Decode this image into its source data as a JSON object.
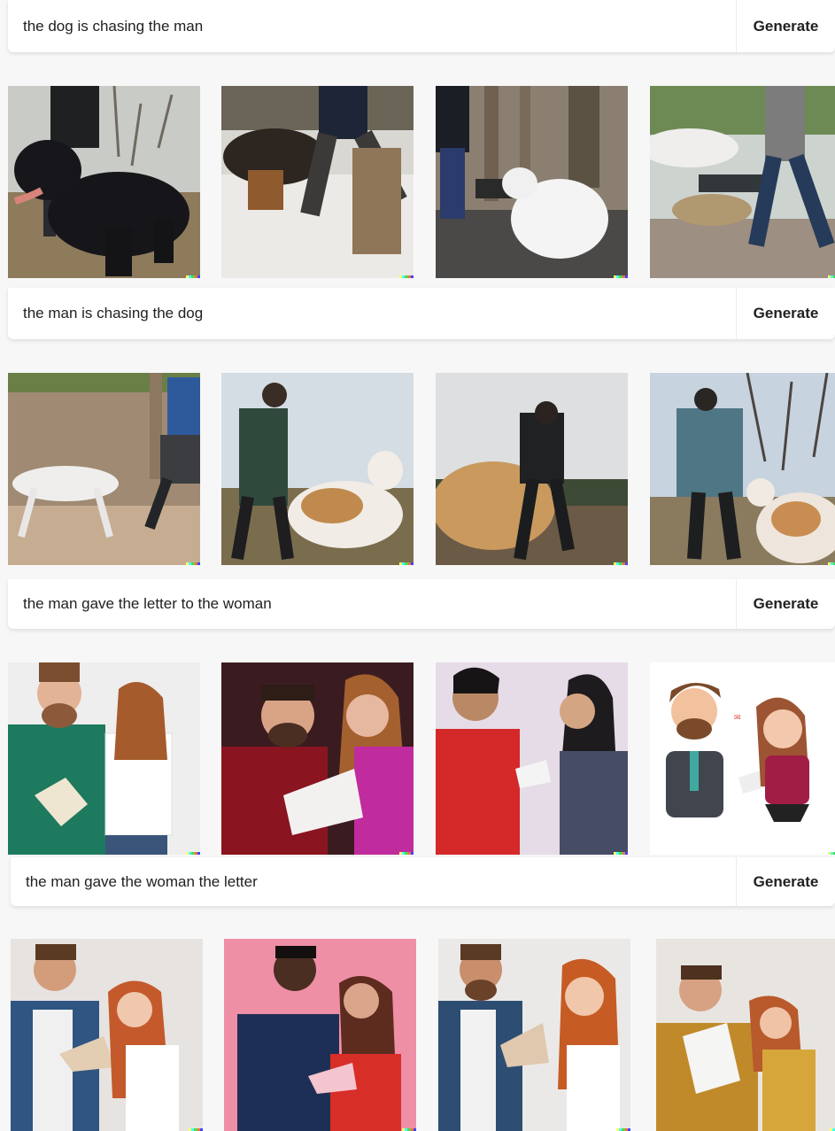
{
  "rows": [
    {
      "prompt": "the dog is chasing the man",
      "button_label": "Generate"
    },
    {
      "prompt": "the man is chasing the dog",
      "button_label": "Generate"
    },
    {
      "prompt": "the man gave the letter to the woman",
      "button_label": "Generate"
    },
    {
      "prompt": "the man gave the woman the letter",
      "button_label": "Generate"
    }
  ],
  "badge_colors": [
    "#ffff66",
    "#42ffff",
    "#51da4c",
    "#ff6e3c",
    "#3c46ff"
  ]
}
